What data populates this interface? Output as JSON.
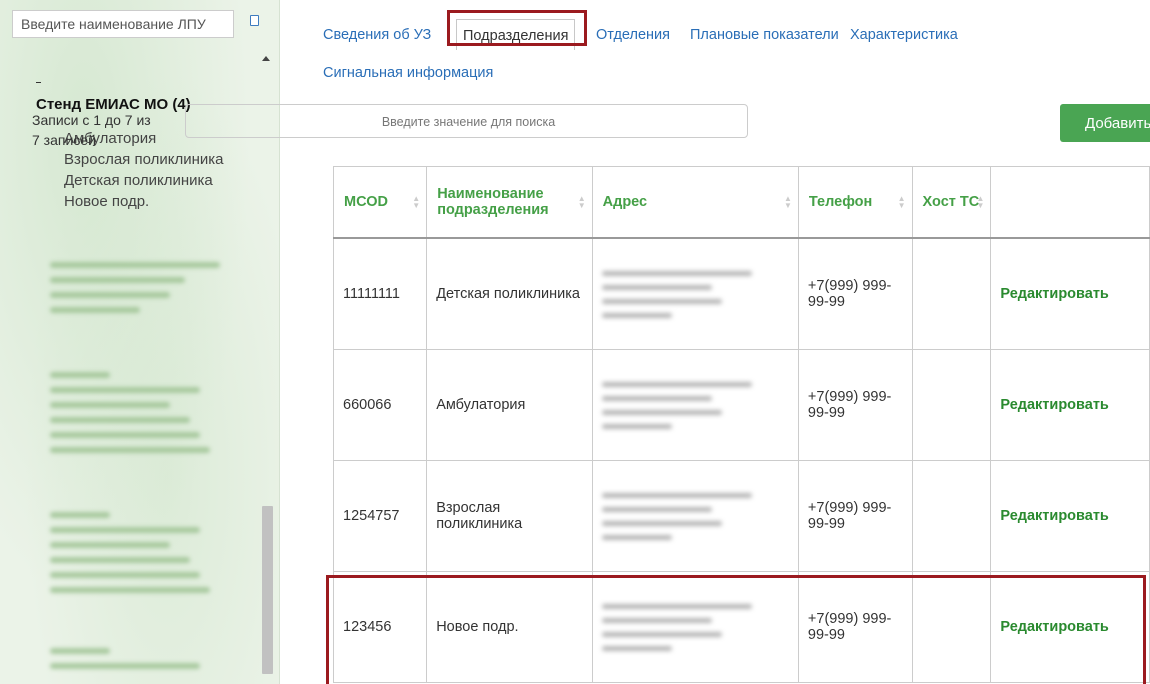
{
  "sidebar": {
    "search_placeholder": "Введите наименование ЛПУ",
    "tree_root_label": "Стенд ЕМИАС МО (4)",
    "tree_children": [
      {
        "label": "Амбулатория"
      },
      {
        "label": "Взрослая поликлиника"
      },
      {
        "label": "Детская поликлиника"
      },
      {
        "label": "Новое подр."
      }
    ]
  },
  "tabs": [
    {
      "label": "Сведения об УЗ"
    },
    {
      "label": "Подразделения"
    },
    {
      "label": "Отделения"
    },
    {
      "label": "Плановые показатели"
    },
    {
      "label": "Характеристика"
    },
    {
      "label": "Сигнальная информация"
    }
  ],
  "toolbar": {
    "records_line1": "Записи с 1 до 7 из",
    "records_line2": "7 записей",
    "search_placeholder": "Введите значение для поиска",
    "add_label": "Добавить"
  },
  "table": {
    "columns": [
      {
        "label": "МСОD"
      },
      {
        "label": "Наименование подразделения"
      },
      {
        "label": "Адрес"
      },
      {
        "label": "Телефон"
      },
      {
        "label": "Хост ТС"
      },
      {
        "label": ""
      }
    ],
    "rows": [
      {
        "mcod": "11111111",
        "name": "Детская поликлиника",
        "phone": "+7(999) 999-99-99",
        "host": "",
        "action": "Редактировать"
      },
      {
        "mcod": "660066",
        "name": "Амбулатория",
        "phone": "+7(999) 999-99-99",
        "host": "",
        "action": "Редактировать"
      },
      {
        "mcod": "1254757",
        "name": "Взрослая поликлиника",
        "phone": "+7(999) 999-99-99",
        "host": "",
        "action": "Редактировать"
      },
      {
        "mcod": "123456",
        "name": "Новое подр.",
        "phone": "+7(999) 999-99-99",
        "host": "",
        "action": "Редактировать"
      }
    ]
  },
  "colors": {
    "link": "#2a6eb7",
    "header_green": "#45a047",
    "edit_green": "#2a8a2f",
    "add_button": "#4aa553",
    "highlight": "#9b1a1f"
  }
}
